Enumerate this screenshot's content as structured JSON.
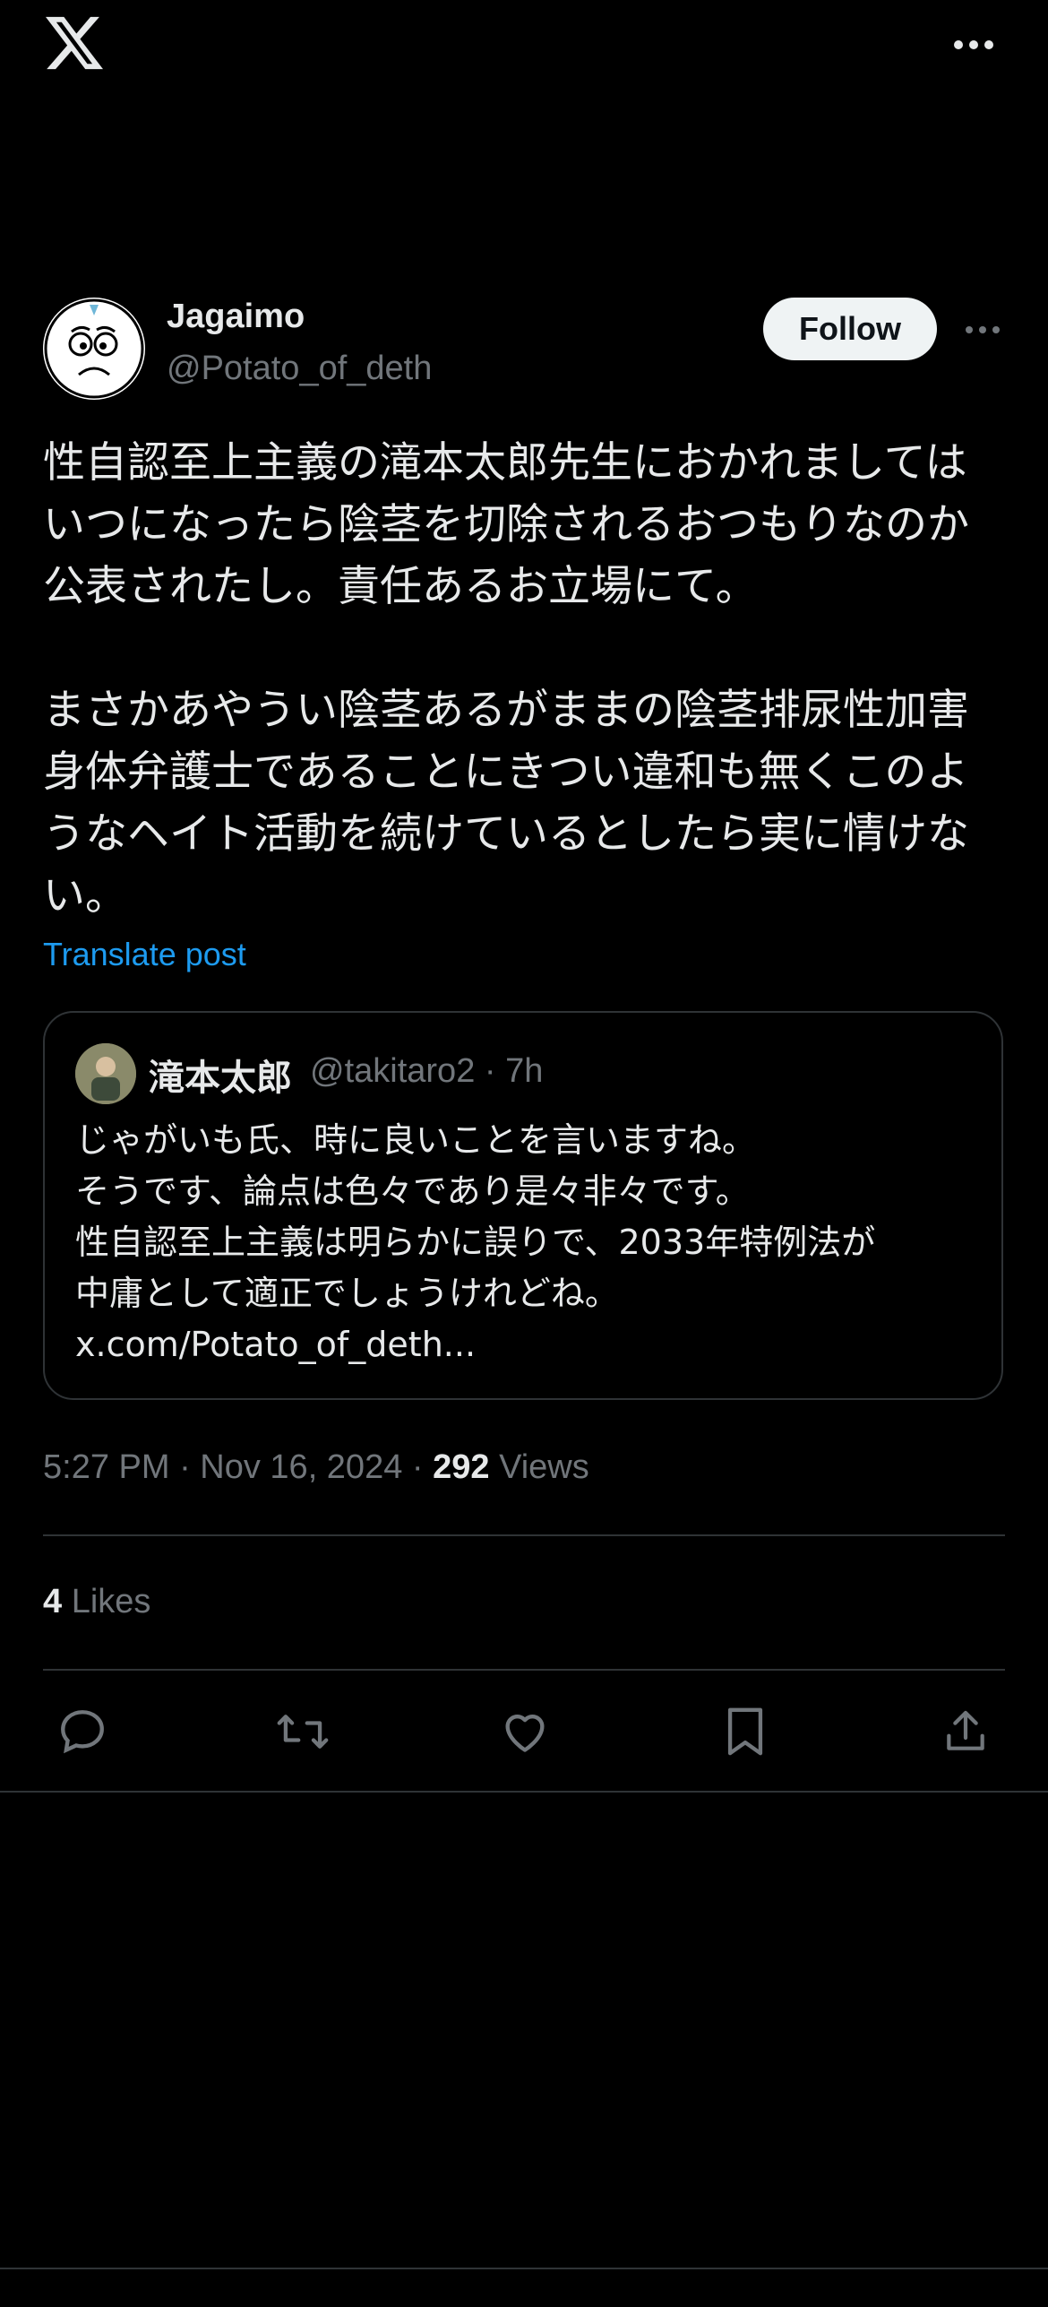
{
  "topbar": {
    "logo_icon": "x-logo-icon",
    "more_icon": "more-horizontal-icon"
  },
  "post": {
    "author_name": "Jagaimo",
    "author_handle": "@Potato_of_deth",
    "follow_label": "Follow",
    "text": "性自認至上主義の滝本太郎先生におかれましては\nいつになったら陰茎を切除されるおつもりなのか\n公表されたし。責任あるお立場にて。\n\nまさかあやうい陰茎あるがままの陰茎排尿性加害\n身体弁護士であることにきつい違和も無くこのよ\nうなヘイト活動を続けているとしたら実に情けな\nい。",
    "translate_label": "Translate post",
    "timestamp": "5:27 PM · Nov 16, 2024 · ",
    "views_count": "292",
    "views_label": " Views",
    "likes_count": "4",
    "likes_label": " Likes"
  },
  "quote": {
    "author_name": "滝本太郎",
    "meta": "@takitaro2 · 7h",
    "text": "じゃがいも氏、時に良いことを言いますね。\nそうです、論点は色々であり是々非々です。\n性自認至上主義は明らかに誤りで、2033年特例法が\n中庸として適正でしょうけれどね。\nx.com/Potato_of_deth..."
  },
  "actions": [
    "reply-icon",
    "repost-icon",
    "like-icon",
    "bookmark-icon",
    "share-icon"
  ],
  "colors": {
    "background": "#000000",
    "text": "#e7e9ea",
    "muted": "#71767b",
    "link": "#1d9bf0",
    "border": "#2f3336"
  }
}
